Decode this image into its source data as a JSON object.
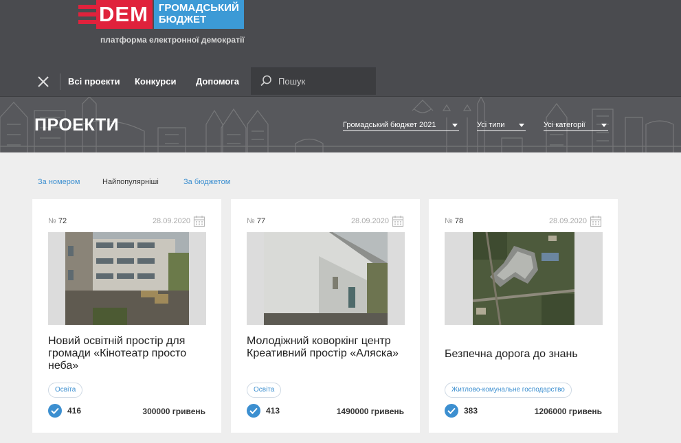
{
  "logo": {
    "dem": "DEM",
    "line1": "ГРОМАДСЬКИЙ",
    "line2": "БЮДЖЕТ"
  },
  "tagline": "платформа електронної демократії",
  "nav": {
    "items": [
      "Всі проекти",
      "Конкурси",
      "Допомога"
    ],
    "search_placeholder": "Пошук"
  },
  "page": {
    "title": "ПРОЕКТИ"
  },
  "filters": [
    {
      "label": "Громадський бюджет 2021"
    },
    {
      "label": "Усі типи"
    },
    {
      "label": "Усі категорії"
    }
  ],
  "sort": [
    "За номером",
    "Найпопулярніші",
    "За бюджетом"
  ],
  "sort_active": "Найпопулярніші",
  "number_symbol": "№",
  "cards": [
    {
      "number": "72",
      "date": "28.09.2020",
      "title": "Новий освітній простір для громади «Кінотеатр просто неба»",
      "tag": "Освіта",
      "votes": "416",
      "budget": "300000 гривень"
    },
    {
      "number": "77",
      "date": "28.09.2020",
      "title": "Молодіжний коворкінг центр Креативний простір «Аляска»",
      "tag": "Освіта",
      "votes": "413",
      "budget": "1490000 гривень"
    },
    {
      "number": "78",
      "date": "28.09.2020",
      "title": "Безпечна дорога до знань",
      "tag": "Житлово-комунальне господарство",
      "votes": "383",
      "budget": "1206000 гривень"
    }
  ],
  "colors": {
    "header_bg": "#4a4b4f",
    "brand_red": "#e0223c",
    "brand_blue": "#3c9ad6",
    "link_blue": "#3c8fd0"
  },
  "icons": [
    "close-icon",
    "search-icon",
    "chevron-down-icon",
    "calendar-icon",
    "check-icon"
  ]
}
